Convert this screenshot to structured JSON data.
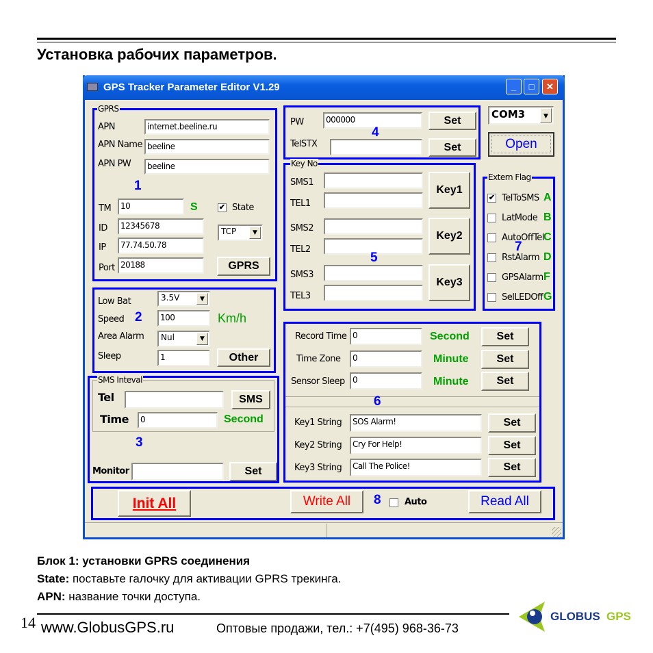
{
  "doc": {
    "heading": "Установка рабочих параметров.",
    "line1": "Блок 1:  установки GPRS соединения",
    "line2_bold": "State:",
    "line2": " поставьте галочку для активации GPRS трекинга.",
    "line3_bold": "APN:",
    "line3": " название точки доступа.",
    "page_number": "14",
    "website": "www.GlobusGPS.ru",
    "phone": "Оптовые продажи, тел.: +7(495) 968-36-73",
    "logo": {
      "text1": "GLOBUS",
      "text2": "GPS"
    }
  },
  "window": {
    "title": "GPS Tracker Parameter Editor V1.29",
    "minimize": "_",
    "maximize": "□",
    "close": "✕"
  },
  "gprs": {
    "legend": "GPRS",
    "apn_label": "APN",
    "apn": "internet.beeline.ru",
    "apn_name_label": "APN Name",
    "apn_name": "beeline",
    "apn_pw_label": "APN PW",
    "apn_pw": "beeline",
    "block_number": "1",
    "tm_label": "TM",
    "tm": "10",
    "tm_unit": "S",
    "state_label": "State",
    "state_checked": true,
    "id_label": "ID",
    "id": "12345678",
    "ip_label": "IP",
    "ip": "77.74.50.78",
    "port_label": "Port",
    "port": "20188",
    "protocol": "TCP",
    "gprs_button": "GPRS"
  },
  "pw": {
    "pw_label": "PW",
    "pw": "000000",
    "telstx_label": "TelSTX",
    "telstx": "",
    "set": "Set",
    "block_number": "4"
  },
  "com": {
    "port": "COM3",
    "open": "Open"
  },
  "keys": {
    "legend": "Key No",
    "block_number": "5",
    "rows": [
      {
        "sms": "SMS1",
        "tel": "TEL1",
        "button": "Key1"
      },
      {
        "sms": "SMS2",
        "tel": "TEL2",
        "button": "Key2"
      },
      {
        "sms": "SMS3",
        "tel": "TEL3",
        "button": "Key3"
      }
    ]
  },
  "flags": {
    "legend": "Extern Flag",
    "block_number": "7",
    "items": [
      {
        "label": "TelToSMS",
        "letter": "A",
        "checked": true
      },
      {
        "label": "LatMode",
        "letter": "B",
        "checked": false
      },
      {
        "label": "AutoOffTel",
        "letter": "C",
        "checked": false
      },
      {
        "label": "RstAlarm",
        "letter": "D",
        "checked": false
      },
      {
        "label": "GPSAlarm",
        "letter": "F",
        "checked": false
      },
      {
        "label": "SelLEDOff",
        "letter": "G",
        "checked": false
      }
    ]
  },
  "other": {
    "block_number": "2",
    "low_bat_label": "Low Bat",
    "low_bat": "3.5V",
    "speed_label": "Speed",
    "speed": "100",
    "speed_unit": "Km/h",
    "area_alarm_label": "Area Alarm",
    "area_alarm": "Nul",
    "sleep_label": "Sleep",
    "sleep": "1",
    "other_button": "Other"
  },
  "sms": {
    "legend": "SMS  Inteval",
    "block_number": "3",
    "tel_label": "Tel",
    "tel": "",
    "sms_button": "SMS",
    "time_label": "Time",
    "time": "0",
    "time_unit": "Second",
    "monitor_label": "Monitor",
    "monitor": "",
    "set": "Set"
  },
  "timing": {
    "block_number": "6",
    "set": "Set",
    "rows": [
      {
        "label": "Record Time",
        "value": "0",
        "unit": "Second"
      },
      {
        "label": "Time Zone",
        "value": "0",
        "unit": "Minute"
      },
      {
        "label": "Sensor Sleep",
        "value": "0",
        "unit": "Minute"
      }
    ],
    "strings": [
      {
        "label": "Key1 String",
        "value": "SOS Alarm!"
      },
      {
        "label": "Key2 String",
        "value": "Cry For Help!"
      },
      {
        "label": "Key3 String",
        "value": "Call The Police!"
      }
    ]
  },
  "actions": {
    "block_number": "8",
    "init_all": "Init All",
    "write_all": "Write All",
    "auto_label": "Auto",
    "auto_checked": false,
    "read_all": "Read All"
  },
  "colors": {
    "block_border": "#0000ff",
    "unit_green": "#00a000",
    "title_bar": "#0a5ee0"
  }
}
